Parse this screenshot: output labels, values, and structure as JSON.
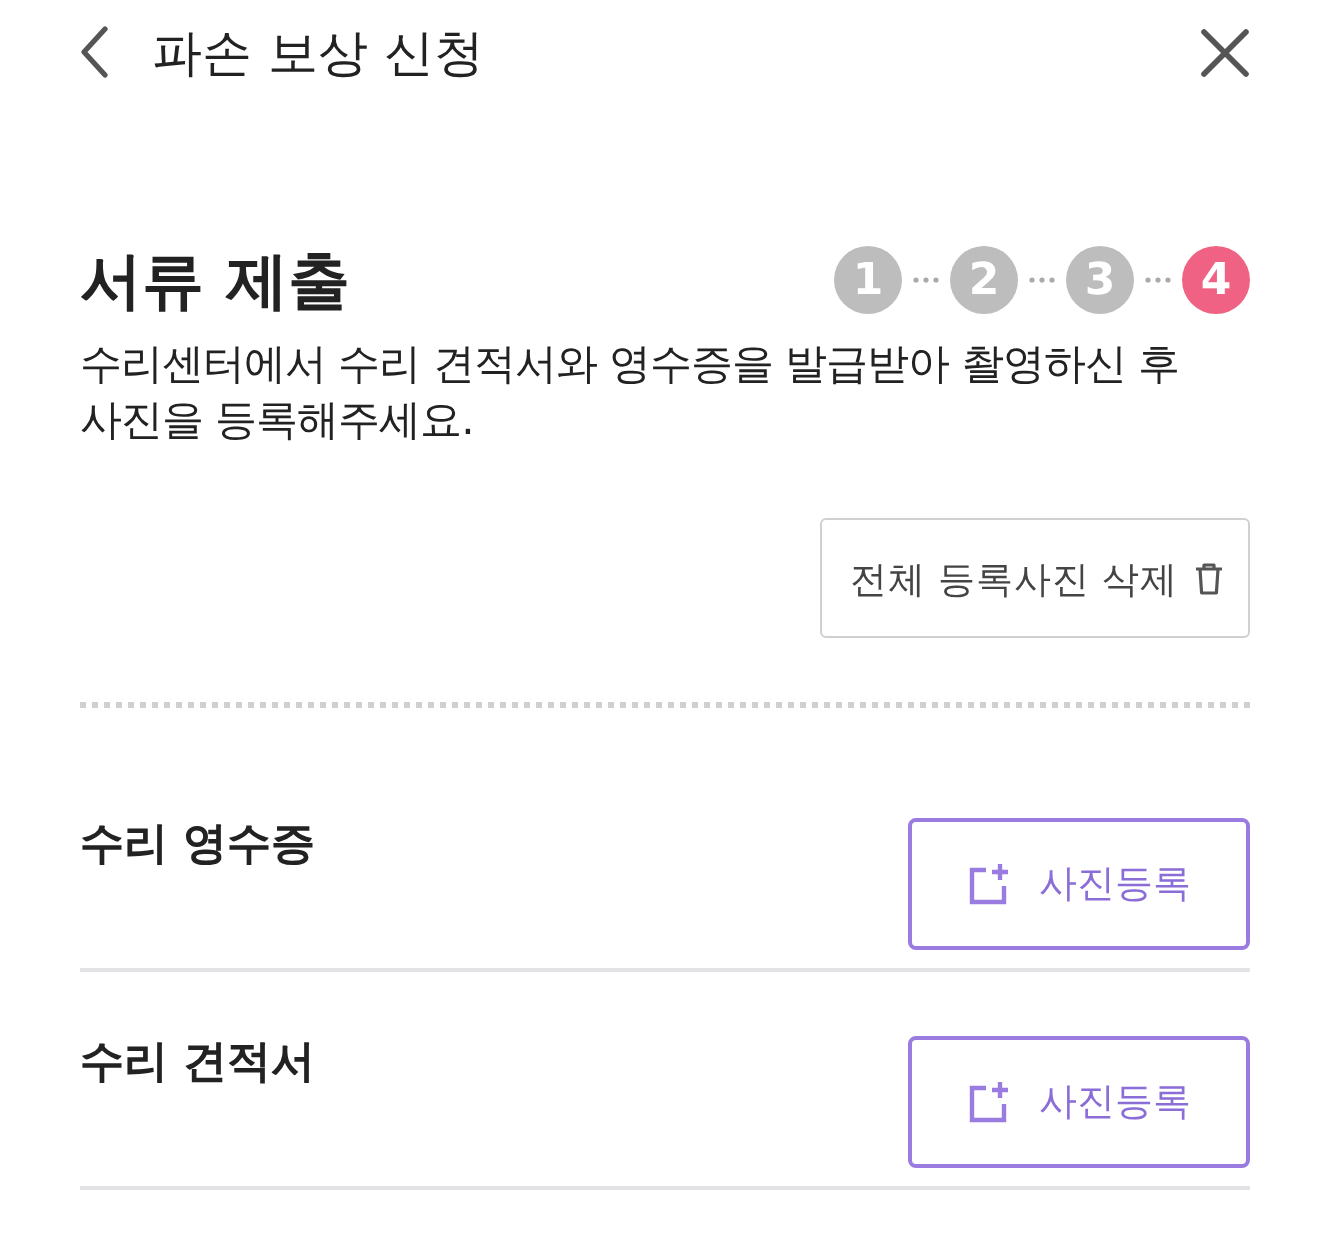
{
  "header": {
    "title": "파손 보상 신청"
  },
  "section": {
    "title": "서류 제출",
    "steps": [
      {
        "label": "1",
        "selected": false
      },
      {
        "label": "2",
        "selected": false
      },
      {
        "label": "3",
        "selected": false
      },
      {
        "label": "4",
        "selected": true
      }
    ],
    "description": "수리센터에서 수리 견적서와 영수증을 발급받아 촬영하신 후 사진을 등록해주세요."
  },
  "delete_all_button": {
    "label": "전체 등록사진 삭제"
  },
  "documents": [
    {
      "label": "수리 영수증",
      "button": "사진등록"
    },
    {
      "label": "수리 견적서",
      "button": "사진등록"
    }
  ]
}
